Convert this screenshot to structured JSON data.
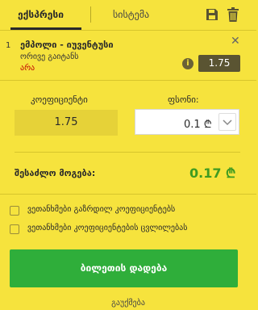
{
  "tabs": {
    "express": "ექსპრესი",
    "system": "სისტემა"
  },
  "bet": {
    "number": "1",
    "match": "ემპოლი - იუვენტუსი",
    "market": "ორივე გაიტანს",
    "outcome": "არა",
    "odds": "1.75"
  },
  "stake": {
    "coef_label": "კოეფიციენტი",
    "amount_label": "ფსონი:",
    "coef_value": "1.75",
    "amount_value": "0.1 ₾"
  },
  "possible_win": {
    "label": "შესაძლო მოგება:",
    "value": "0.17 ₾"
  },
  "options": [
    {
      "label": "ვეთანხმები გაზრდილ კოეფიციენტებს"
    },
    {
      "label": "ვეთანხმები კოეფიციენტების ცვლილებას"
    }
  ],
  "place_bet_label": "ბილეთის დადება",
  "footer_text": "გაუქმება",
  "colors": {
    "background": "#f6e33d",
    "accent_green": "#2fae3a",
    "win_green": "#3f9b21",
    "outcome_red": "#c20000"
  }
}
